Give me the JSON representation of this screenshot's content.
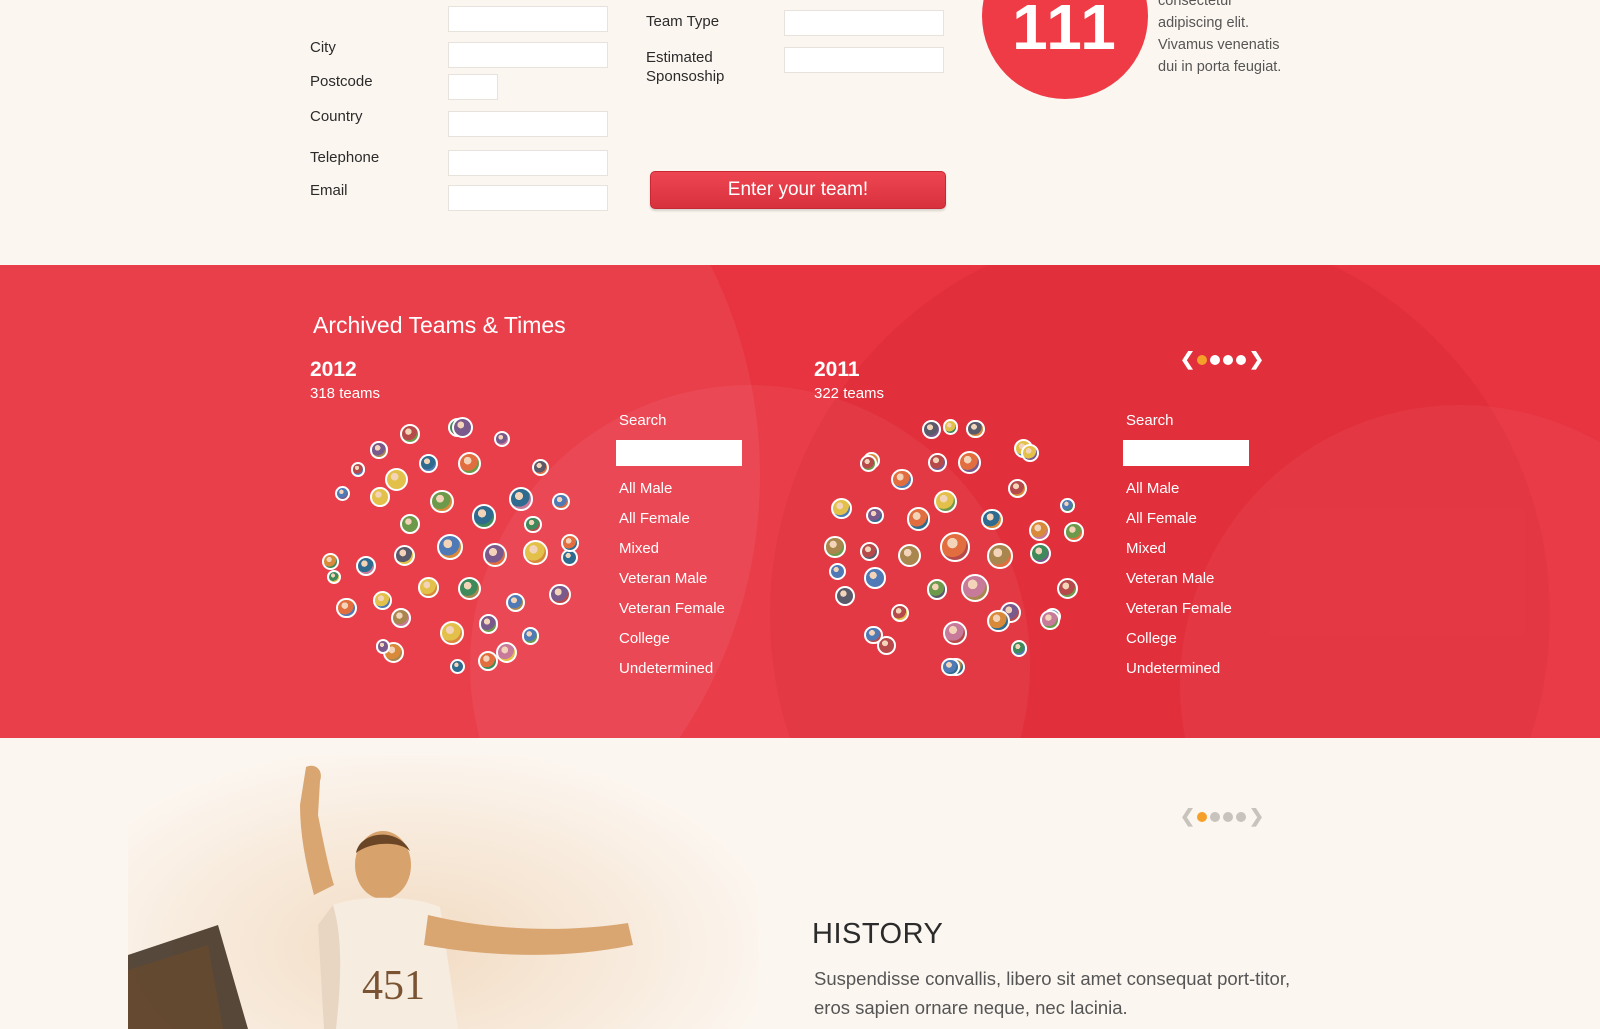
{
  "form": {
    "labels": {
      "city": "City",
      "postcode": "Postcode",
      "country": "Country",
      "telephone": "Telephone",
      "email": "Email",
      "team_type": "Team Type",
      "estimated_sponsorship": "Estimated Sponsoship"
    },
    "submit_label": "Enter your team!"
  },
  "promo": {
    "big_number": "111",
    "text": "consectetur adipiscing elit. Vivamus venenatis dui in porta feugiat."
  },
  "archive": {
    "title": "Archived Teams & Times",
    "pager": {
      "prev": "❮",
      "next": "❯",
      "dots": 4,
      "active": 0
    },
    "columns": [
      {
        "year": "2012",
        "teams": "318 teams",
        "search_label": "Search",
        "categories": [
          "All Male",
          "All Female",
          "Mixed",
          "Veteran Male",
          "Veteran Female",
          "College",
          "Undetermined"
        ]
      },
      {
        "year": "2011",
        "teams": "322 teams",
        "search_label": "Search",
        "categories": [
          "All Male",
          "All Female",
          "Mixed",
          "Veteran Male",
          "Veteran Female",
          "College",
          "Undetermined"
        ]
      }
    ]
  },
  "history": {
    "pager": {
      "prev": "❮",
      "next": "❯",
      "dots": 4,
      "active": 0
    },
    "photo_number": "451",
    "title": "HISTORY",
    "text": "Suspendisse convallis, libero sit amet consequat port-titor, eros sapien ornare neque, nec lacinia."
  },
  "colors": {
    "accent_red": "#e83340",
    "pager_active": "#f5a02a",
    "pager_inactive_on_red": "#ffffff",
    "pager_inactive_on_light": "#c9c3bd"
  }
}
